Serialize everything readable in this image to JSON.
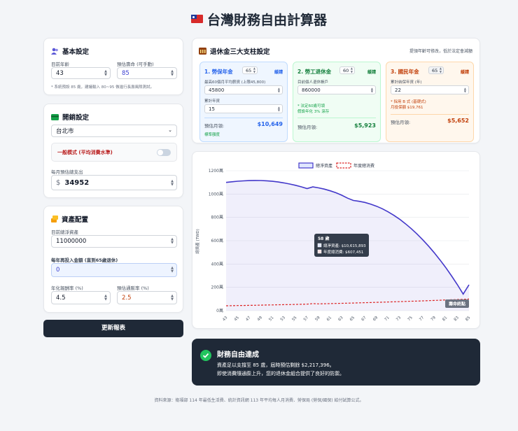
{
  "page": {
    "title": "台灣財務自由計算器",
    "footer": "資料來源：衛福部 114 年最低生活費、統計資訊網 113 年平均每人月消費、勞保局 (勞保/國保) 給付試算公式。"
  },
  "basic": {
    "heading": "基本設定",
    "age_label": "目前年齡",
    "age_value": "43",
    "life_label": "預估壽命 (可手動)",
    "life_value": "85",
    "note": "* 系統預設 85 歲，建議輸入 80~95 做進行長壽風險測試。"
  },
  "spend": {
    "heading": "開銷設定",
    "city": "台北市",
    "mode_label": "一般模式 (平均消費水準)",
    "monthly_label": "每月預估總支出",
    "currency": "$",
    "monthly_value": "34952"
  },
  "assets": {
    "heading": "資產配置",
    "net_label": "目前總淨資產",
    "net_value": "11000000",
    "invest_label": "每年再投入金額 (直到65歲退休)",
    "invest_value": "0",
    "ret_label": "年化報酬率 (%)",
    "ret_value": "4.5",
    "inf_label": "預估通膨率 (%)",
    "inf_value": "2.5"
  },
  "update_button": "更新報表",
  "pension": {
    "heading": "退休金三大支柱設定",
    "hint": "提領年齡可修改，低於法定會減額",
    "labor": {
      "name": "1. 勞保年金",
      "age": "65",
      "status": "緩請",
      "salary_label": "最高60個月平均薪資 (上限45,800)",
      "salary_value": "45800",
      "years_label": "累計年資",
      "years_value": "15",
      "monthly_label": "預估月領:",
      "monthly_value": "$10,649",
      "tag": "標準額度"
    },
    "retire": {
      "name": "2. 勞工退休金",
      "age": "60",
      "status": "緩請",
      "account_label": "目前個人退休帳戶",
      "account_value": "860000",
      "note1": "* 法定60歲可領",
      "note2": "假設年化 3% 滾存",
      "monthly_label": "預估月領:",
      "monthly_value": "$5,923"
    },
    "national": {
      "name": "3. 國民年金",
      "age": "65",
      "status": "緩請",
      "years_label": "累計納保年資 (年)",
      "years_value": "22",
      "note1": "* 採用 B 式 (基礎式)",
      "note2": "月投保額 $19,761",
      "monthly_label": "預估月領:",
      "monthly_value": "$5,652"
    }
  },
  "chart": {
    "legend_assets": "總淨資產",
    "legend_spend": "年度總消費",
    "ylabel": "總資產 (TWD)",
    "tooltip_title": "58 歲",
    "tooltip_assets": "總淨資產: $10,615,893",
    "tooltip_spend": "年度總消費: $607,451",
    "end_label": "壽命終點"
  },
  "result": {
    "title": "財務自由達成",
    "line1": "資產足以支撐至 85 歲，屆時預估剩餘 $2,217,396。",
    "line2": "即使消費隨通膨上升，您的退休金組合提供了良好的防禦。"
  },
  "colors": {
    "labor": "#3b6fd8",
    "retire": "#16a34a",
    "national": "#c2410c",
    "assets_line": "#4338ca",
    "spend_line": "#dc2626"
  },
  "chart_data": {
    "type": "line",
    "x": [
      43,
      44,
      45,
      46,
      47,
      48,
      49,
      50,
      51,
      52,
      53,
      54,
      55,
      56,
      57,
      58,
      59,
      60,
      61,
      62,
      63,
      64,
      65,
      66,
      67,
      68,
      69,
      70,
      71,
      72,
      73,
      74,
      75,
      76,
      77,
      78,
      79,
      80,
      81,
      82,
      83,
      84,
      85
    ],
    "x_tick_labels": [
      "43",
      "45",
      "47",
      "49",
      "51",
      "53",
      "55",
      "57",
      "59",
      "61",
      "63",
      "65",
      "67",
      "69",
      "71",
      "73",
      "75",
      "77",
      "79",
      "81",
      "83",
      "85"
    ],
    "y_tick_labels": [
      "0萬",
      "200萬",
      "400萬",
      "600萬",
      "800萬",
      "1000萬",
      "1200萬"
    ],
    "ylim": [
      0,
      12000000
    ],
    "series": [
      {
        "name": "總淨資產",
        "values": [
          11000000,
          11052000,
          11098000,
          11133000,
          11155000,
          11164000,
          11158000,
          11135000,
          11094000,
          11035000,
          10958000,
          10862000,
          10750000,
          10620000,
          10470000,
          10615893,
          10530000,
          10420000,
          10280000,
          10110000,
          9900000,
          9650000,
          9450000,
          9380000,
          9280000,
          9140000,
          8960000,
          8740000,
          8480000,
          8180000,
          7840000,
          7460000,
          7040000,
          6580000,
          6080000,
          5540000,
          4960000,
          4340000,
          3680000,
          2970000,
          2220000,
          1420000,
          2217396
        ]
      },
      {
        "name": "年度總消費",
        "values": [
          420000,
          428000,
          437000,
          446000,
          455000,
          464000,
          473000,
          483000,
          493000,
          503000,
          513000,
          524000,
          535000,
          546000,
          557000,
          607451,
          580000,
          592000,
          604000,
          617000,
          630000,
          643000,
          656000,
          670000,
          684000,
          698000,
          713000,
          728000,
          743000,
          759000,
          775000,
          791000,
          808000,
          825000,
          842000,
          860000,
          878000,
          897000,
          916000,
          935000,
          955000,
          975000,
          996000
        ]
      }
    ]
  }
}
